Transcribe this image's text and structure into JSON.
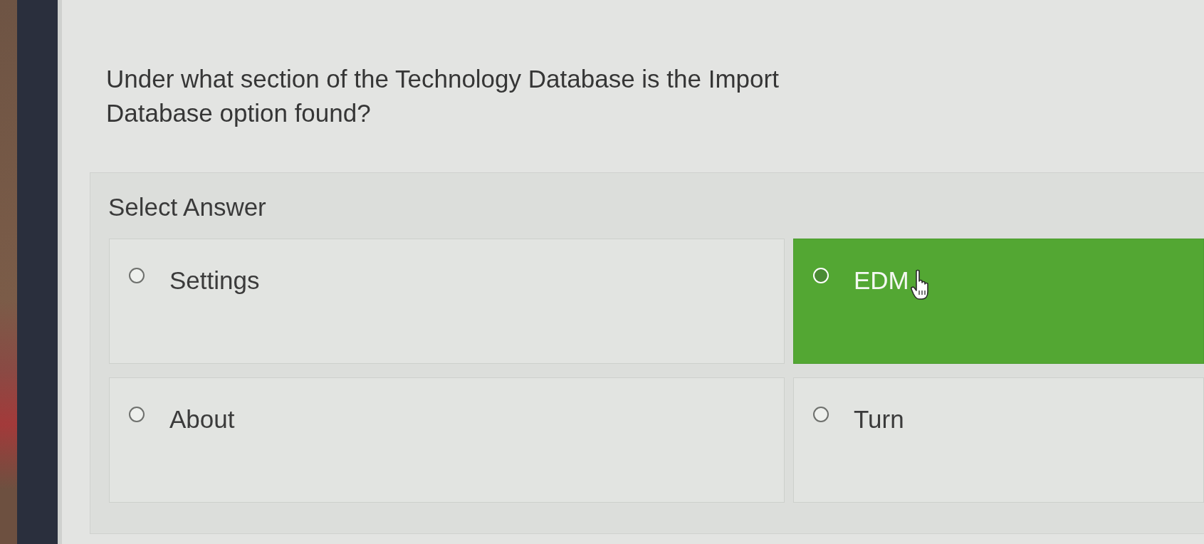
{
  "question": "Under what section of the Technology Database is the Import Database option found?",
  "answer_panel": {
    "heading": "Select Answer",
    "options": [
      {
        "label": "Settings",
        "selected": false,
        "hovered": false
      },
      {
        "label": "EDM",
        "selected": false,
        "hovered": true
      },
      {
        "label": "About",
        "selected": false,
        "hovered": false
      },
      {
        "label": "Turn",
        "selected": false,
        "hovered": false
      }
    ]
  }
}
